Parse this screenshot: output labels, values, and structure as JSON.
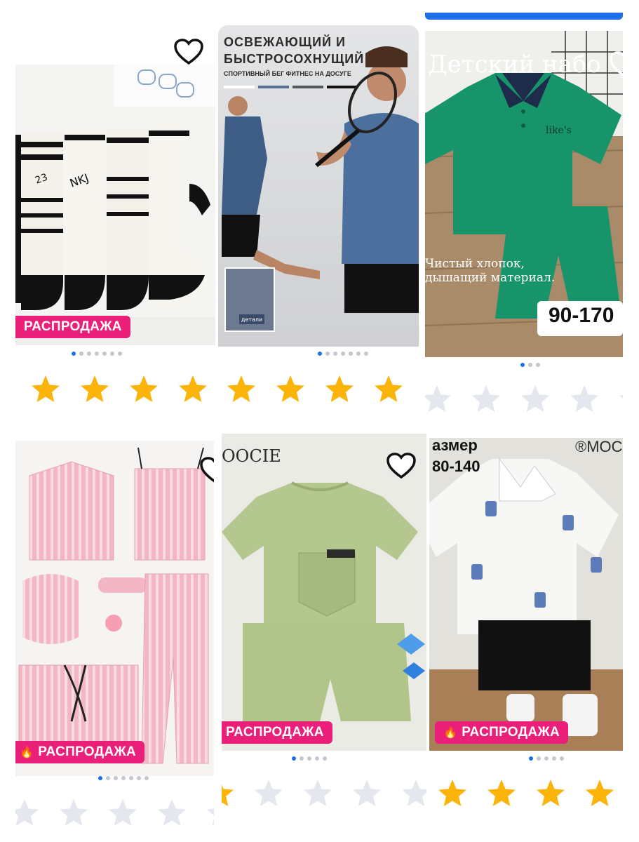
{
  "products": [
    {
      "id": "socks",
      "badge": "РАСПРОДАЖА",
      "image_text": [
        "NKJ",
        "23"
      ],
      "dots": 7,
      "active_dot": 0,
      "rating": 5
    },
    {
      "id": "sport",
      "badge": "",
      "image_text": [
        "ОСВЕЖАЮЩИЙ И",
        "БЫСТРОСОХНУЩИЙ",
        "СПОРТИВНЫЙ БЕГ ФИТНЕС НА ДОСУГЕ",
        "детали"
      ],
      "dots": 7,
      "active_dot": 0,
      "rating": 5
    },
    {
      "id": "kids-polo",
      "badge": "",
      "image_text": [
        "Детский набо",
        "Чистый хлопок,",
        "дышащий материал.",
        "90-170",
        "like's"
      ],
      "dots": 3,
      "active_dot": 0,
      "rating": 0
    },
    {
      "id": "pajama",
      "badge": "РАСПРОДАЖА",
      "image_text": [],
      "dots": 7,
      "active_dot": 0,
      "rating": 0
    },
    {
      "id": "green-set",
      "badge": "РАСПРОДАЖА",
      "image_text": [
        "OOCIE"
      ],
      "dots": 5,
      "active_dot": 0,
      "rating": 1
    },
    {
      "id": "robot-set",
      "badge": "РАСПРОДАЖА",
      "image_text": [
        "азмер",
        "80-140",
        "®MOC"
      ],
      "dots": 5,
      "active_dot": 0,
      "rating": 4
    }
  ],
  "colors": {
    "badge": "#ea1f79",
    "star_on": "#fbb40a",
    "star_off": "#e4e7ee",
    "dot_on": "#1f6feb",
    "dot_off": "#c4c7cf",
    "accent": "#1f6feb"
  },
  "icons": {
    "favorite": "heart-icon",
    "rating": "star-icon",
    "hot": "fire-icon"
  }
}
